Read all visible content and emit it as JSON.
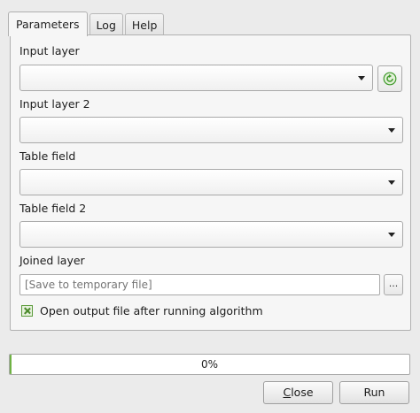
{
  "tabs": [
    {
      "label": "Parameters",
      "active": true
    },
    {
      "label": "Log",
      "active": false
    },
    {
      "label": "Help",
      "active": false
    }
  ],
  "fields": {
    "input_layer": {
      "label": "Input layer",
      "value": ""
    },
    "input_layer_2": {
      "label": "Input layer 2",
      "value": ""
    },
    "table_field": {
      "label": "Table field",
      "value": ""
    },
    "table_field_2": {
      "label": "Table field 2",
      "value": ""
    },
    "joined_layer": {
      "label": "Joined layer",
      "placeholder": "[Save to temporary file]",
      "browse_label": "..."
    }
  },
  "open_output_checkbox": {
    "label": "Open output file after running algorithm",
    "checked": true
  },
  "progress": {
    "text": "0%",
    "value": 0.0
  },
  "buttons": {
    "close_mnemonic": "C",
    "close_rest": "lose",
    "run_label": "Run"
  },
  "colors": {
    "progress_fill": "#6fb244",
    "checkbox_accent": "#5c9c3c",
    "iterate_icon": "#3f9a2b"
  },
  "icons": {
    "iterate": "iterate-icon",
    "dropdown": "chevron-down-icon"
  }
}
